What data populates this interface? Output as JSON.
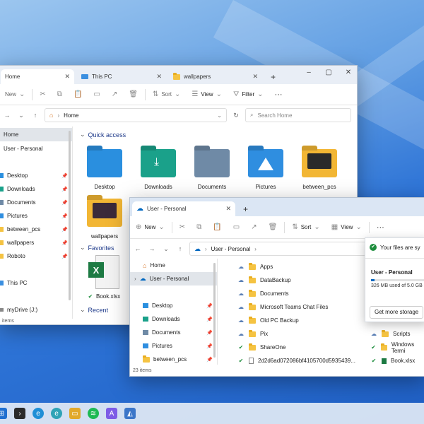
{
  "colors": {
    "accent": "#0067c0",
    "folder": "#f5c342",
    "check": "#1e8e3e"
  },
  "back_window": {
    "tabs": [
      {
        "label": "Home",
        "icon": "home-icon"
      },
      {
        "label": "This PC",
        "icon": "monitor-icon"
      },
      {
        "label": "wallpapers",
        "icon": "folder-icon"
      }
    ],
    "toolbar": {
      "new_label": "New",
      "sort_label": "Sort",
      "view_label": "View",
      "filter_label": "Filter"
    },
    "address": {
      "crumb": "Home",
      "search_placeholder": "Search Home"
    },
    "sidebar": [
      {
        "label": "Home",
        "icon": "home-icon"
      },
      {
        "label": "User - Personal",
        "icon": "cloud-icon"
      },
      {
        "label": "Desktop",
        "icon": "desktop-icon"
      },
      {
        "label": "Downloads",
        "icon": "download-icon"
      },
      {
        "label": "Documents",
        "icon": "document-icon"
      },
      {
        "label": "Pictures",
        "icon": "picture-icon"
      },
      {
        "label": "between_pcs",
        "icon": "folder-icon"
      },
      {
        "label": "wallpapers",
        "icon": "folder-icon"
      },
      {
        "label": "Roboto",
        "icon": "folder-icon"
      },
      {
        "label": "This PC",
        "icon": "monitor-icon"
      },
      {
        "label": "myDrive (J:)",
        "icon": "drive-icon"
      }
    ],
    "quick_access_header": "Quick access",
    "quick_access": [
      {
        "label": "Desktop",
        "color": "#2a8fdf"
      },
      {
        "label": "Downloads",
        "color": "#1aa18a"
      },
      {
        "label": "Documents",
        "color": "#6f8aa6"
      },
      {
        "label": "Pictures",
        "color": "#2f8ee0"
      },
      {
        "label": "between_pcs",
        "color": "#f2b634"
      },
      {
        "label": "wallpapers",
        "color": "#f2b634"
      }
    ],
    "favorites_header": "Favorites",
    "favorite_file": "Book.xlsx",
    "recent_header": "Recent",
    "status": "items"
  },
  "front_window": {
    "tab": {
      "label": "User - Personal"
    },
    "toolbar": {
      "new_label": "New",
      "sort_label": "Sort",
      "view_label": "View"
    },
    "address": {
      "crumb": "User - Personal"
    },
    "sidebar": [
      {
        "label": "Home",
        "icon": "home-icon"
      },
      {
        "label": "User - Personal",
        "icon": "cloud-icon"
      },
      {
        "label": "Desktop",
        "icon": "desktop-icon"
      },
      {
        "label": "Downloads",
        "icon": "download-icon"
      },
      {
        "label": "Documents",
        "icon": "document-icon"
      },
      {
        "label": "Pictures",
        "icon": "picture-icon"
      },
      {
        "label": "between_pcs",
        "icon": "folder-icon"
      }
    ],
    "files": [
      {
        "name": "Apps",
        "status": "cloud"
      },
      {
        "name": "DataBackup",
        "status": "cloud"
      },
      {
        "name": "Documents",
        "status": "cloud"
      },
      {
        "name": "Microsoft Teams Chat Files",
        "status": "cloud"
      },
      {
        "name": "Old PC Backup",
        "status": "cloud"
      },
      {
        "name": "Pix",
        "status": "cloud"
      },
      {
        "name": "ShareOne",
        "status": "check"
      },
      {
        "name": "2d2d6ad072086bf4105700d5935439...",
        "status": "check"
      }
    ],
    "right_files": [
      {
        "name": "Scripts",
        "status": "cloud"
      },
      {
        "name": "Windows Termi",
        "status": "check"
      },
      {
        "name": "Book.xlsx",
        "status": "check"
      }
    ],
    "status": "23 items",
    "onedrive_popup": {
      "synced": "Your files are sy",
      "account": "User - Personal",
      "storage": "326 MB used of 5.0 GB",
      "storage_fraction": 0.064,
      "more_storage": "Get more storage"
    }
  },
  "taskbar": [
    {
      "name": "start",
      "color": "#1f6fd0"
    },
    {
      "name": "terminal",
      "color": "#2b2b2b"
    },
    {
      "name": "edge",
      "color": "#1f8fd6"
    },
    {
      "name": "edge-beta",
      "color": "#2fa3b6"
    },
    {
      "name": "file-explorer",
      "color": "#e2a92a"
    },
    {
      "name": "spotify",
      "color": "#1db954"
    },
    {
      "name": "app",
      "color": "#7d5ce6"
    },
    {
      "name": "photos",
      "color": "#3c76c8"
    }
  ]
}
